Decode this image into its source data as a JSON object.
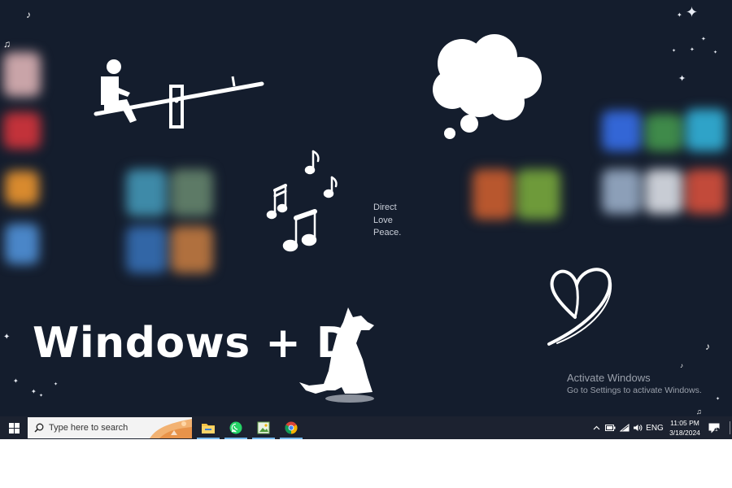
{
  "desktop": {
    "caption": "Windows + D",
    "motto": [
      "Direct",
      "Love",
      "Peace."
    ],
    "watermark": {
      "title": "Activate Windows",
      "subtitle": "Go to Settings to activate Windows."
    },
    "background_color": "#141d2d"
  },
  "taskbar": {
    "search_placeholder": "Type here to search",
    "pinned_apps": [
      {
        "name": "File Explorer",
        "icon": "folder-icon"
      },
      {
        "name": "WhatsApp",
        "icon": "whatsapp-icon"
      },
      {
        "name": "Photos",
        "icon": "image-app-icon"
      },
      {
        "name": "Google Chrome",
        "icon": "chrome-icon"
      }
    ],
    "tray": {
      "language": "ENG",
      "time": "11:05 PM",
      "date": "3/18/2024",
      "notification_count": "1"
    },
    "accent_color": "#76b9ed"
  }
}
